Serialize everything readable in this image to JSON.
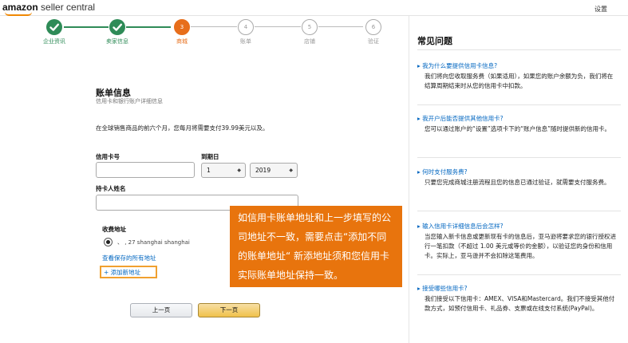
{
  "header": {
    "logo_brand": "amazon",
    "logo_rest": " seller central",
    "settings_label": "设置"
  },
  "steps": [
    {
      "number": "",
      "label": "企业资讯",
      "state": "done"
    },
    {
      "number": "",
      "label": "卖家信息",
      "state": "done"
    },
    {
      "number": "3",
      "label": "商城",
      "state": "current"
    },
    {
      "number": "4",
      "label": "账单",
      "state": "todo"
    },
    {
      "number": "5",
      "label": "店铺",
      "state": "todo"
    },
    {
      "number": "6",
      "label": "验证",
      "state": "todo"
    }
  ],
  "billing": {
    "title": "账单信息",
    "subtitle": "信用卡和银行账户详细信息",
    "notice": "在全球销售商品的前六个月，您每月将需要支付39.99美元以及。",
    "card_number_label": "信用卡号",
    "card_number_value": "",
    "expiry_label": "到期日",
    "expiry_month": "1",
    "expiry_year": "2019",
    "holder_label": "持卡人姓名",
    "holder_value": "",
    "address_title": "收费地址",
    "address_text": "、        ,      27 shanghai shanghai",
    "view_all_link": "查看保存的所有地址",
    "add_address_link": "+ 添加新地址",
    "prev_button": "上一页",
    "next_button": "下一页"
  },
  "callout": {
    "text": "如信用卡账单地址和上一步填写的公司地址不一致，需要点击“添加不同的账单地址“ 新添地址须和您信用卡实际账单地址保持一致。"
  },
  "faq": {
    "title": "常见问题",
    "items": [
      {
        "q": "▸ 我为什么要提供信用卡信息?",
        "a": "我们将向您收取服务费（如果适用），如果您的账户余额为负，我们将在结算周期结束时从您的信用卡中扣款。"
      },
      {
        "q": "▸ 我开户后能否提供其他信用卡?",
        "a": "您可以通过账户的“设置”选项卡下的“账户信息”随时提供新的信用卡。"
      },
      {
        "q": "▸ 何时支付服务费?",
        "a": "只要您完成商城注册流程且您的信息已通过验证，就需要支付服务费。"
      },
      {
        "q": "▸ 输入信用卡详细信息后会怎样?",
        "a": "当您输入新卡信息或更新现有卡的信息后，亚马逊将要求您的银行授权进行一笔扣款（不超过 1.00 美元或等价的金额），以验证您的身份和信用卡。实际上，亚马逊并不会扣除这笔费用。"
      },
      {
        "q": "▸ 接受哪些信用卡?",
        "a": "我们接受以下信用卡：AMEX、VISA和Mastercard。我们不接受其他付款方式，如预付信用卡、礼品券、支票或在线支付系统(PayPal)。"
      }
    ]
  },
  "colors": {
    "done": "#2e8b57",
    "current": "#e76e1b",
    "link": "#0066c0",
    "callout": "#e8740d"
  }
}
